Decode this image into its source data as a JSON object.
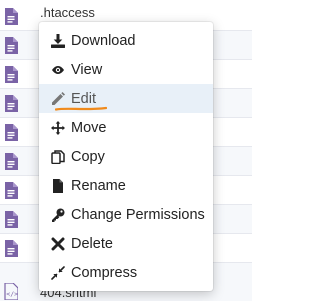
{
  "files": [
    {
      "name": ".htaccess"
    },
    {
      "name": ""
    },
    {
      "name": ""
    },
    {
      "name": ""
    },
    {
      "name": ""
    },
    {
      "name": ""
    },
    {
      "name": ""
    },
    {
      "name": ""
    },
    {
      "name": ""
    },
    {
      "name": "404.shtml"
    }
  ],
  "context_menu": {
    "items": [
      {
        "label": "Download",
        "icon": "download-icon"
      },
      {
        "label": "View",
        "icon": "eye-icon"
      },
      {
        "label": "Edit",
        "icon": "pencil-icon",
        "active": true
      },
      {
        "label": "Move",
        "icon": "move-arrows-icon"
      },
      {
        "label": "Copy",
        "icon": "copy-icon"
      },
      {
        "label": "Rename",
        "icon": "file-icon"
      },
      {
        "label": "Change Permissions",
        "icon": "key-icon"
      },
      {
        "label": "Delete",
        "icon": "x-icon"
      },
      {
        "label": "Compress",
        "icon": "compress-icon"
      }
    ]
  },
  "colors": {
    "file_icon": "#7a63a6",
    "highlight_row": "#e8f0f8",
    "annotation_underline": "#f08a1c"
  }
}
